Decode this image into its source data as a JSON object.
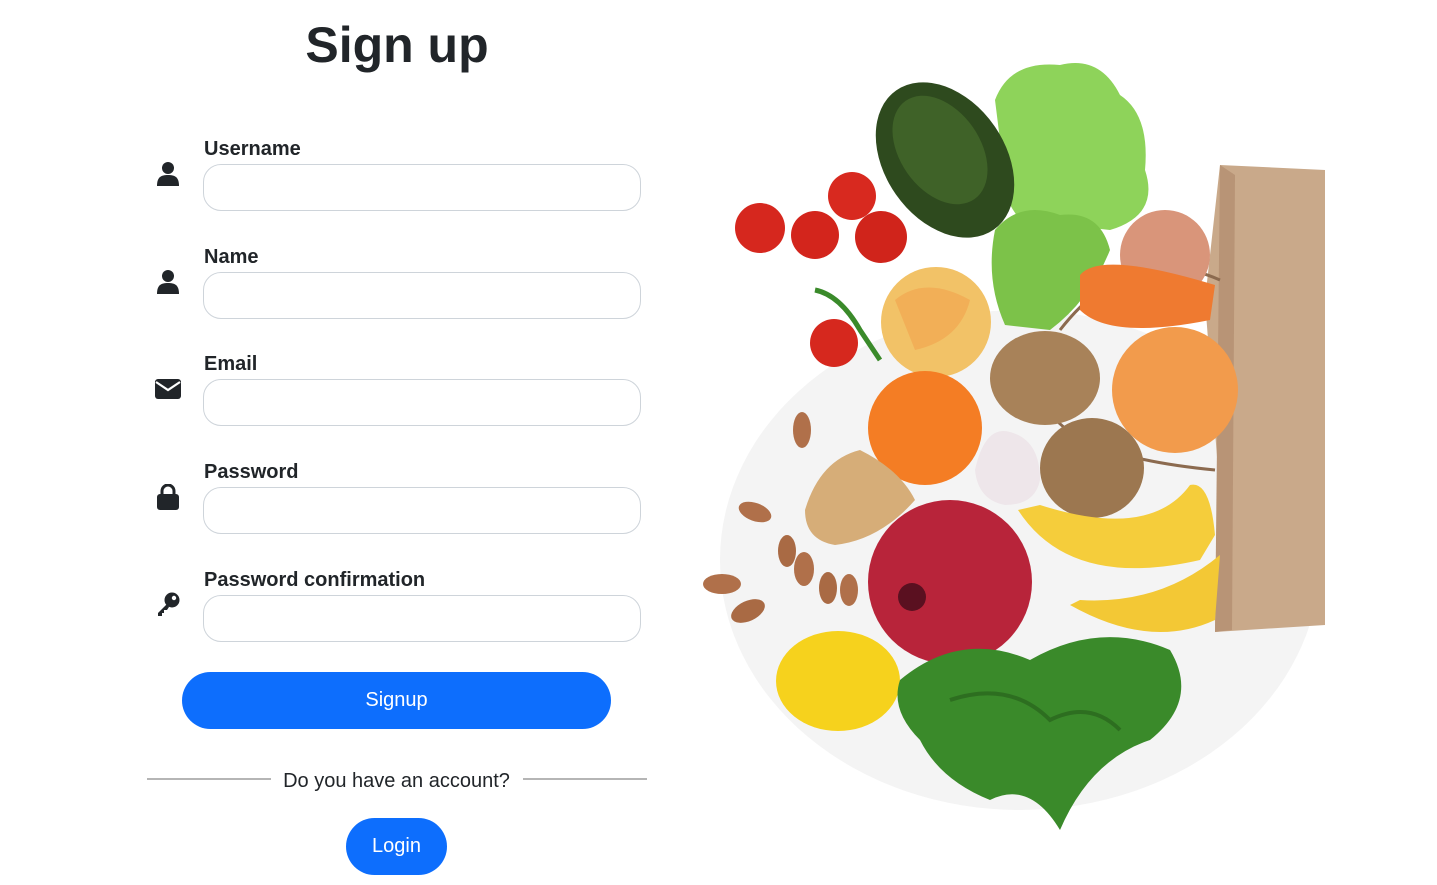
{
  "page": {
    "title": "Sign up"
  },
  "form": {
    "fields": [
      {
        "label": "Username",
        "icon": "user-icon",
        "value": "",
        "placeholder": ""
      },
      {
        "label": "Name",
        "icon": "user-icon",
        "value": "",
        "placeholder": ""
      },
      {
        "label": "Email",
        "icon": "envelope-icon",
        "value": "",
        "placeholder": ""
      },
      {
        "label": "Password",
        "icon": "lock-icon",
        "value": "",
        "placeholder": ""
      },
      {
        "label": "Password confirmation",
        "icon": "key-icon",
        "value": "",
        "placeholder": ""
      }
    ],
    "signup_label": "Signup",
    "divider_text": "Do you have an account?",
    "login_label": "Login"
  },
  "hero": {
    "image": "grocery-bag-vegetables-illustration"
  },
  "colors": {
    "primary": "#0d6efd",
    "text": "#212529",
    "input_border": "#ced4da",
    "divider": "#b5b5b5"
  }
}
